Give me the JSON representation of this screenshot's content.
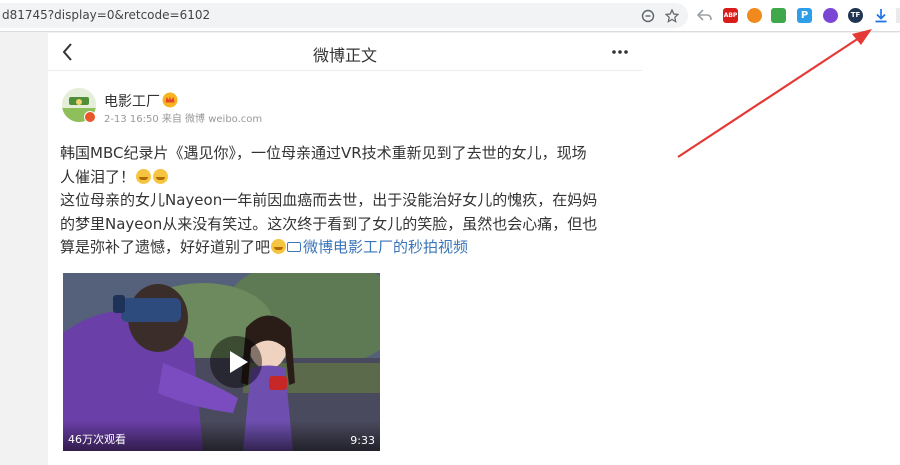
{
  "browser": {
    "url": "d81745?display=0&retcode=6102",
    "extensions": [
      {
        "name": "abp",
        "label": "ABP",
        "color": "#d81b1b"
      },
      {
        "name": "orange-ext",
        "label": "",
        "color": "#f08a1c"
      },
      {
        "name": "green-ext",
        "label": "",
        "color": "#3ea84b"
      },
      {
        "name": "p-ext",
        "label": "P",
        "color": "#2f9ee8"
      },
      {
        "name": "purple-ext",
        "label": "",
        "color": "#7b45d6"
      },
      {
        "name": "tf-ext",
        "label": "TF",
        "color": "#1f3552"
      }
    ],
    "colors": {
      "accent": "#1a73e8",
      "arrow": "#e53935"
    }
  },
  "nav": {
    "title": "微博正文"
  },
  "post": {
    "author": "电影工厂",
    "meta": "2-13 16:50 来自 微博 weibo.com",
    "lines": [
      "韩国MBC纪录片《遇见你》，一位母亲通过VR技术重新见到了去世的女儿，现场",
      "人催泪了！",
      "这位母亲的女儿Nayeon一年前因血癌而去世，出于没能治好女儿的愧疚，在妈妈",
      "的梦里Nayeon从来没有笑过。这次终于看到了女儿的笑脸，虽然也会心痛，但也",
      "算是弥补了遗憾，好好道别了吧"
    ],
    "video_link": "微博电影工厂的秒拍视频",
    "video": {
      "views": "46万次观看",
      "duration": "9:33"
    }
  }
}
